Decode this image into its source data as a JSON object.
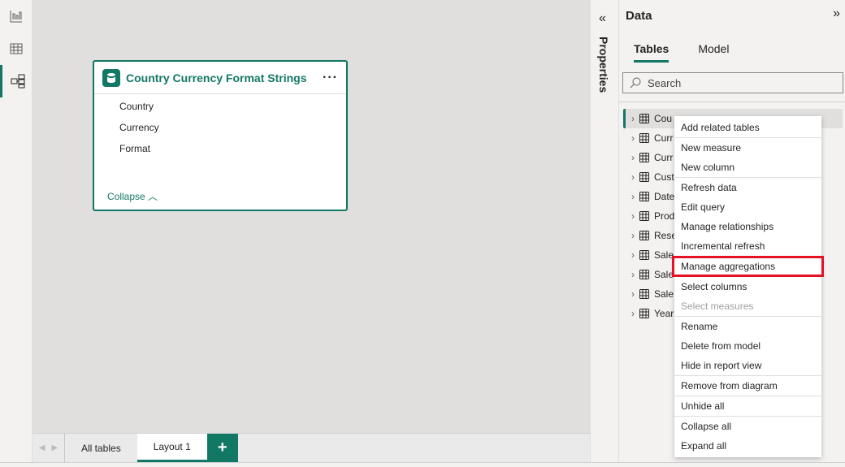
{
  "rail": {
    "items": [
      {
        "icon": "report-view-icon"
      },
      {
        "icon": "table-view-icon"
      },
      {
        "icon": "model-view-icon",
        "active": true
      }
    ]
  },
  "card": {
    "title": "Country Currency Format Strings",
    "fields": [
      "Country",
      "Currency",
      "Format"
    ],
    "collapse": "Collapse"
  },
  "bottom_tabs": {
    "all_tables": "All tables",
    "layout": "Layout 1",
    "add": "+"
  },
  "properties": {
    "label": "Properties"
  },
  "data_pane": {
    "title": "Data",
    "tabs": [
      "Tables",
      "Model"
    ],
    "search_placeholder": "Search",
    "tables": [
      "Cou",
      "Curr",
      "Curr",
      "Cust",
      "Date",
      "Prod",
      "Rese",
      "Sale",
      "Sale",
      "Sale",
      "Year"
    ]
  },
  "context_menu": {
    "groups": [
      [
        "Add related tables"
      ],
      [
        "New measure",
        "New column"
      ],
      [
        "Refresh data",
        "Edit query",
        "Manage relationships",
        "Incremental refresh",
        "Manage aggregations",
        "Select columns",
        "Select measures"
      ],
      [
        "Rename",
        "Delete from model",
        "Hide in report view"
      ],
      [
        "Remove from diagram"
      ],
      [
        "Unhide all"
      ],
      [
        "Collapse all",
        "Expand all"
      ]
    ],
    "highlighted": "Manage aggregations",
    "disabled": [
      "Select measures"
    ]
  },
  "colors": {
    "accent": "#117865",
    "highlight": "#e81123"
  }
}
